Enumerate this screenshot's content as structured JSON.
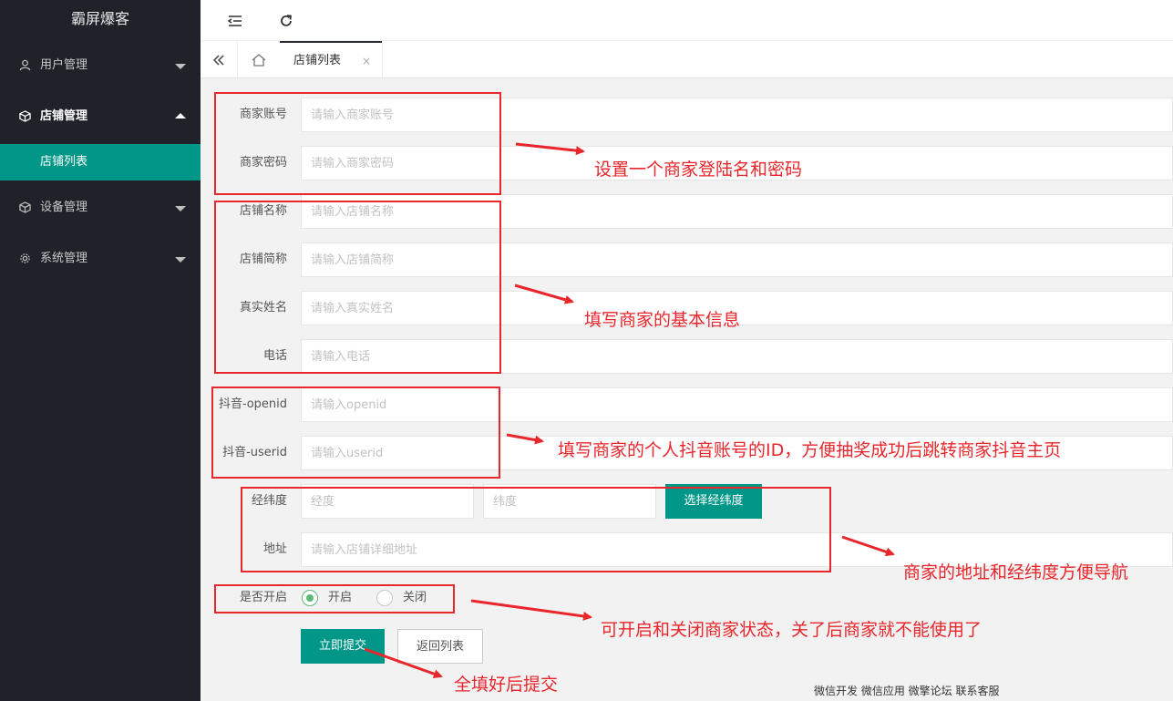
{
  "brand": "霸屏爆客",
  "sidebar": {
    "items": [
      {
        "label": "用户管理",
        "icon": "user-icon"
      },
      {
        "label": "店铺管理",
        "icon": "cube-icon"
      },
      {
        "label": "设备管理",
        "icon": "cube-icon"
      },
      {
        "label": "系统管理",
        "icon": "gear-icon"
      }
    ],
    "sub_item": "店铺列表"
  },
  "header": {
    "menu_icon": "menu-fold-icon",
    "refresh_icon": "refresh-icon"
  },
  "tabs": {
    "active_label": "店铺列表",
    "close": "×"
  },
  "form": {
    "account": {
      "label": "商家账号",
      "placeholder": "请输入商家账号"
    },
    "password": {
      "label": "商家密码",
      "placeholder": "请输入商家密码"
    },
    "shop_name": {
      "label": "店铺名称",
      "placeholder": "请输入店铺名称"
    },
    "shop_short": {
      "label": "店铺简称",
      "placeholder": "请输入店铺简称"
    },
    "real_name": {
      "label": "真实姓名",
      "placeholder": "请输入真实姓名"
    },
    "phone": {
      "label": "电话",
      "placeholder": "请输入电话"
    },
    "openid": {
      "label": "抖音-openid",
      "placeholder": "请输入openid"
    },
    "userid": {
      "label": "抖音-userid",
      "placeholder": "请输入userid"
    },
    "latlng": {
      "label": "经纬度",
      "lng_placeholder": "经度",
      "lat_placeholder": "纬度",
      "button": "选择经纬度"
    },
    "address": {
      "label": "地址",
      "placeholder": "请输入店铺详细地址"
    },
    "enabled": {
      "label": "是否开启",
      "on": "开启",
      "off": "关闭",
      "selected": "开启"
    },
    "submit": "立即提交",
    "back": "返回列表"
  },
  "footer": "微信开发 微信应用 微擎论坛 联系客服",
  "annotations": {
    "a1": "设置一个商家登陆名和密码",
    "a2": "填写商家的基本信息",
    "a3": "填写商家的个人抖音账号的ID，方便抽奖成功后跳转商家抖音主页",
    "a4": "商家的地址和经纬度方便导航",
    "a5": "可开启和关闭商家状态，关了后商家就不能使用了",
    "a6": "全填好后提交"
  },
  "colors": {
    "accent": "#009688",
    "sidebar": "#20222a",
    "annotation": "#e8262b",
    "radio_on": "#5fb878"
  }
}
